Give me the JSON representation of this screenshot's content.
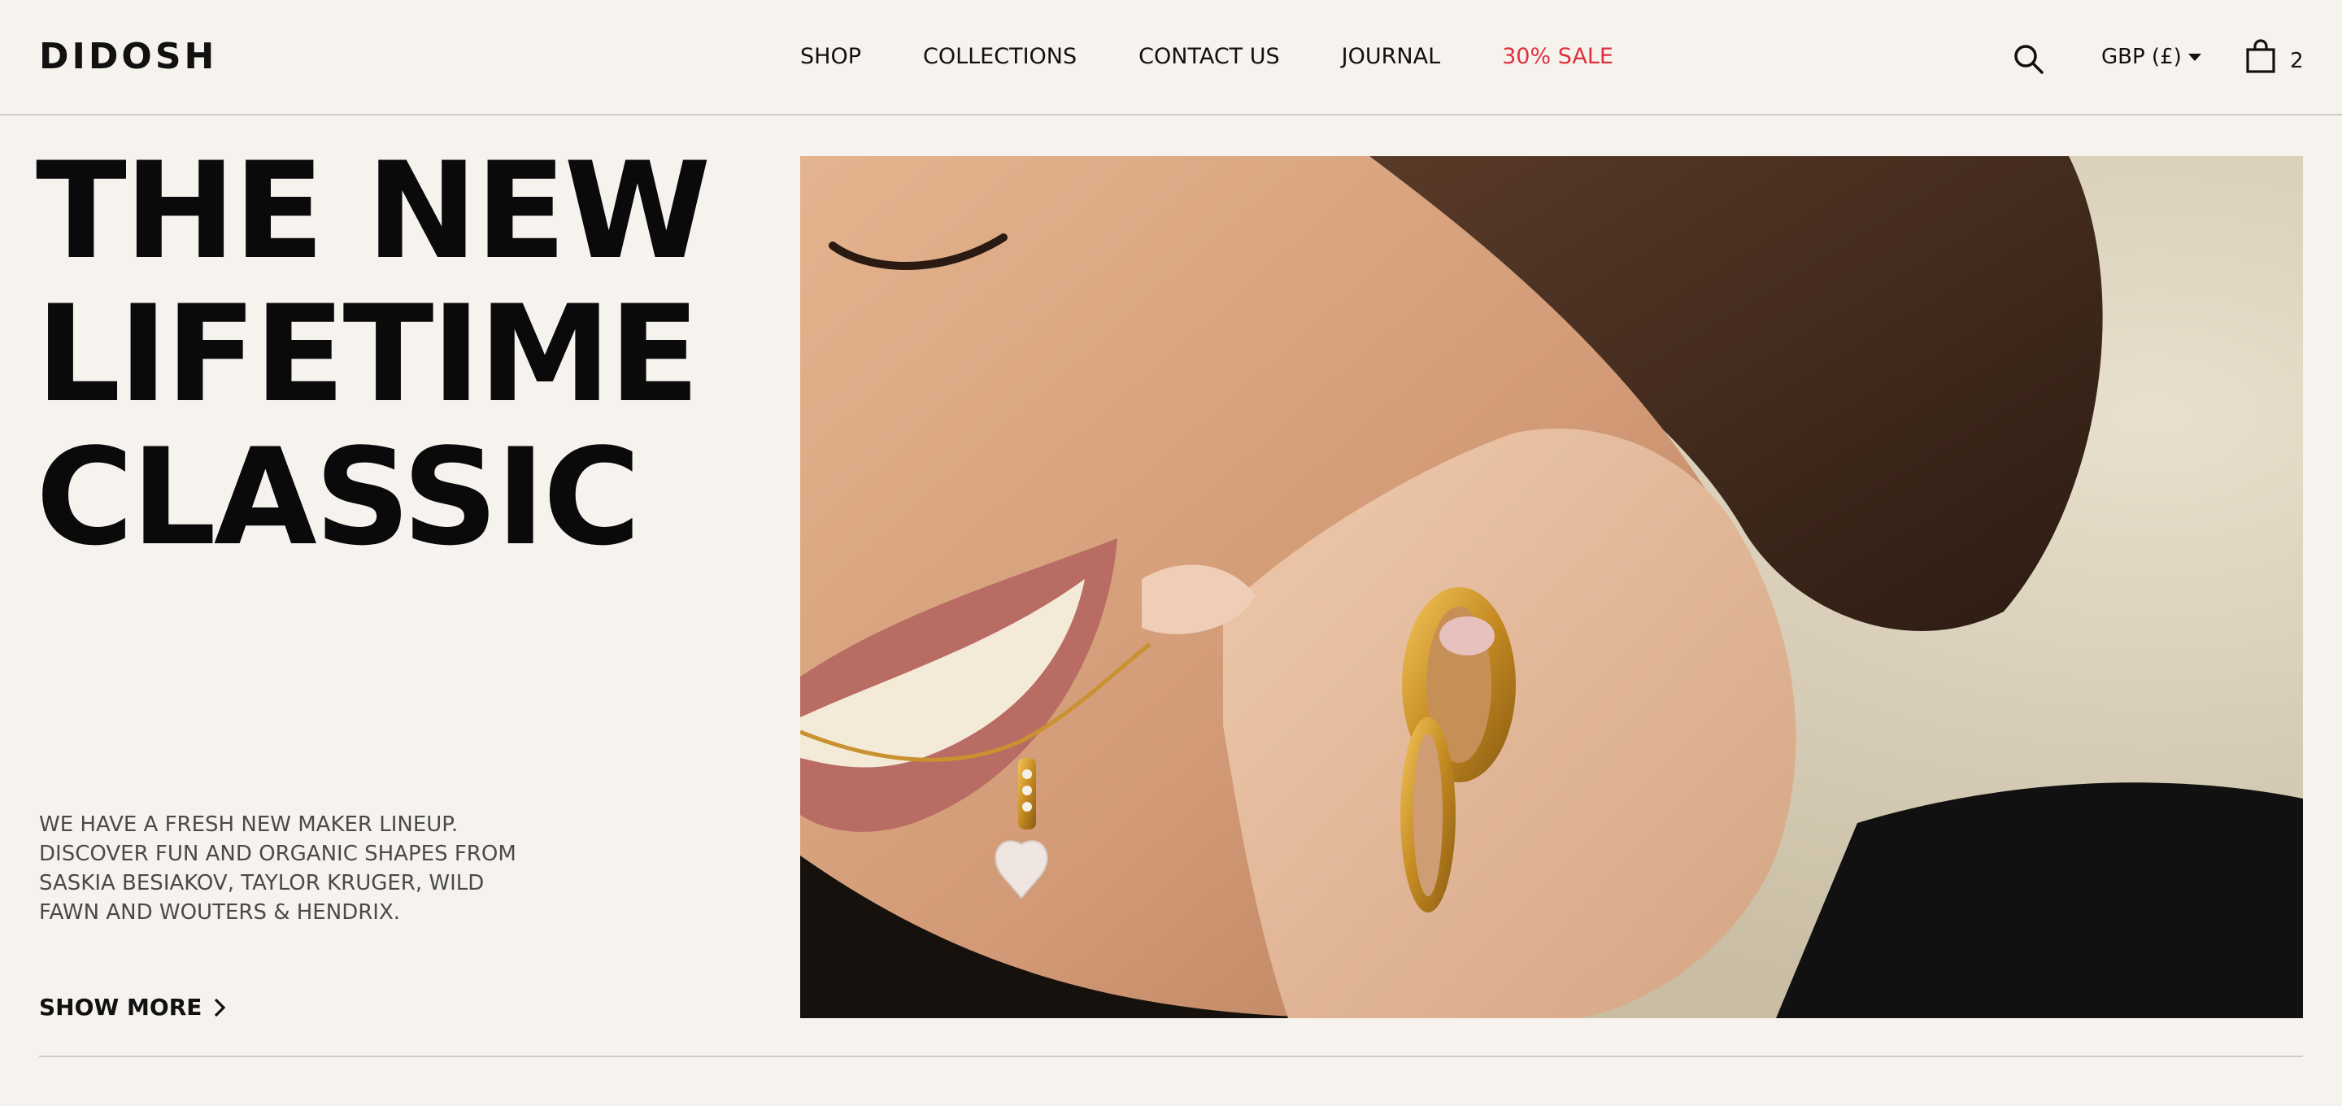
{
  "header": {
    "logo": "DIDOSH",
    "nav": {
      "shop": "SHOP",
      "collections": "COLLECTIONS",
      "contact": "CONTACT US",
      "journal": "JOURNAL",
      "sale": "30% SALE"
    },
    "currency": "GBP (£)",
    "cart_count": "2"
  },
  "hero": {
    "title_line1": "THE NEW",
    "title_line2": "LIFETIME",
    "title_line3": "CLASSIC",
    "description": "WE HAVE A FRESH NEW MAKER LINEUP. DISCOVER FUN AND ORGANIC SHAPES FROM SASKIA BESIAKOV, TAYLOR KRUGER, WILD FAWN AND WOUTERS & HENDRIX.",
    "cta_label": "SHOW MORE"
  },
  "colors": {
    "background": "#f6f3ef",
    "sale": "#e0303e",
    "text": "#111111"
  }
}
